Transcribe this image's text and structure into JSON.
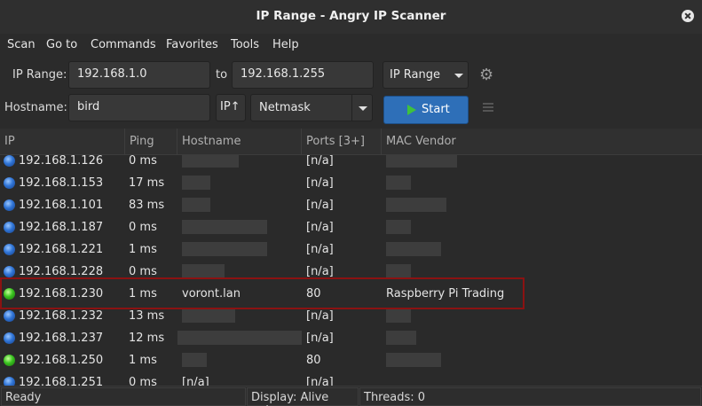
{
  "window": {
    "title": "IP Range - Angry IP Scanner"
  },
  "menu": {
    "items": [
      "Scan",
      "Go to",
      "Commands",
      "Favorites",
      "Tools",
      "Help"
    ]
  },
  "toolbar": {
    "ip_range_label": "IP Range:",
    "ip_start": "192.168.1.0",
    "to_label": "to",
    "ip_end": "192.168.1.255",
    "feeder_select": "IP Range",
    "hostname_label": "Hostname:",
    "hostname_value": "bird",
    "ip_up_label": "IP↑",
    "netmask_select": "Netmask",
    "start_label": "Start",
    "prefs_icon": "gear-icon",
    "fetchers_icon": "list-icon",
    "start_color": "#2e6fb8"
  },
  "table": {
    "headers": [
      "IP",
      "Ping",
      "Hostname",
      "Ports [3+]",
      "MAC Vendor"
    ],
    "rows": [
      {
        "status": "blue",
        "ip": "192.168.1.126",
        "ping": "0 ms",
        "hostname": "",
        "ports": "[n/a]",
        "vendor": ""
      },
      {
        "status": "blue",
        "ip": "192.168.1.153",
        "ping": "17 ms",
        "hostname": "",
        "ports": "[n/a]",
        "vendor": ""
      },
      {
        "status": "blue",
        "ip": "192.168.1.101",
        "ping": "83 ms",
        "hostname": "",
        "ports": "[n/a]",
        "vendor": ""
      },
      {
        "status": "blue",
        "ip": "192.168.1.187",
        "ping": "0 ms",
        "hostname": "",
        "ports": "[n/a]",
        "vendor": ""
      },
      {
        "status": "blue",
        "ip": "192.168.1.221",
        "ping": "1 ms",
        "hostname": "",
        "ports": "[n/a]",
        "vendor": ""
      },
      {
        "status": "blue",
        "ip": "192.168.1.228",
        "ping": "0 ms",
        "hostname": "",
        "ports": "[n/a]",
        "vendor": ""
      },
      {
        "status": "green",
        "ip": "192.168.1.230",
        "ping": "1 ms",
        "hostname": "voront.lan",
        "ports": "80",
        "vendor": "Raspberry Pi Trading"
      },
      {
        "status": "blue",
        "ip": "192.168.1.232",
        "ping": "13 ms",
        "hostname": "",
        "ports": "[n/a]",
        "vendor": ""
      },
      {
        "status": "blue",
        "ip": "192.168.1.237",
        "ping": "12 ms",
        "hostname": "",
        "ports": "[n/a]",
        "vendor": ""
      },
      {
        "status": "green",
        "ip": "192.168.1.250",
        "ping": "1 ms",
        "hostname": "",
        "ports": "80",
        "vendor": ""
      },
      {
        "status": "blue",
        "ip": "192.168.1.251",
        "ping": "0 ms",
        "hostname": "[n/a]",
        "ports": "[n/a]",
        "vendor": ""
      }
    ]
  },
  "status": {
    "left": "Ready",
    "display": "Display: Alive only",
    "threads": "Threads: 0"
  },
  "colors": {
    "highlight": "#8b1212",
    "alive": "#39c31f",
    "dead": "#2f74d6"
  }
}
